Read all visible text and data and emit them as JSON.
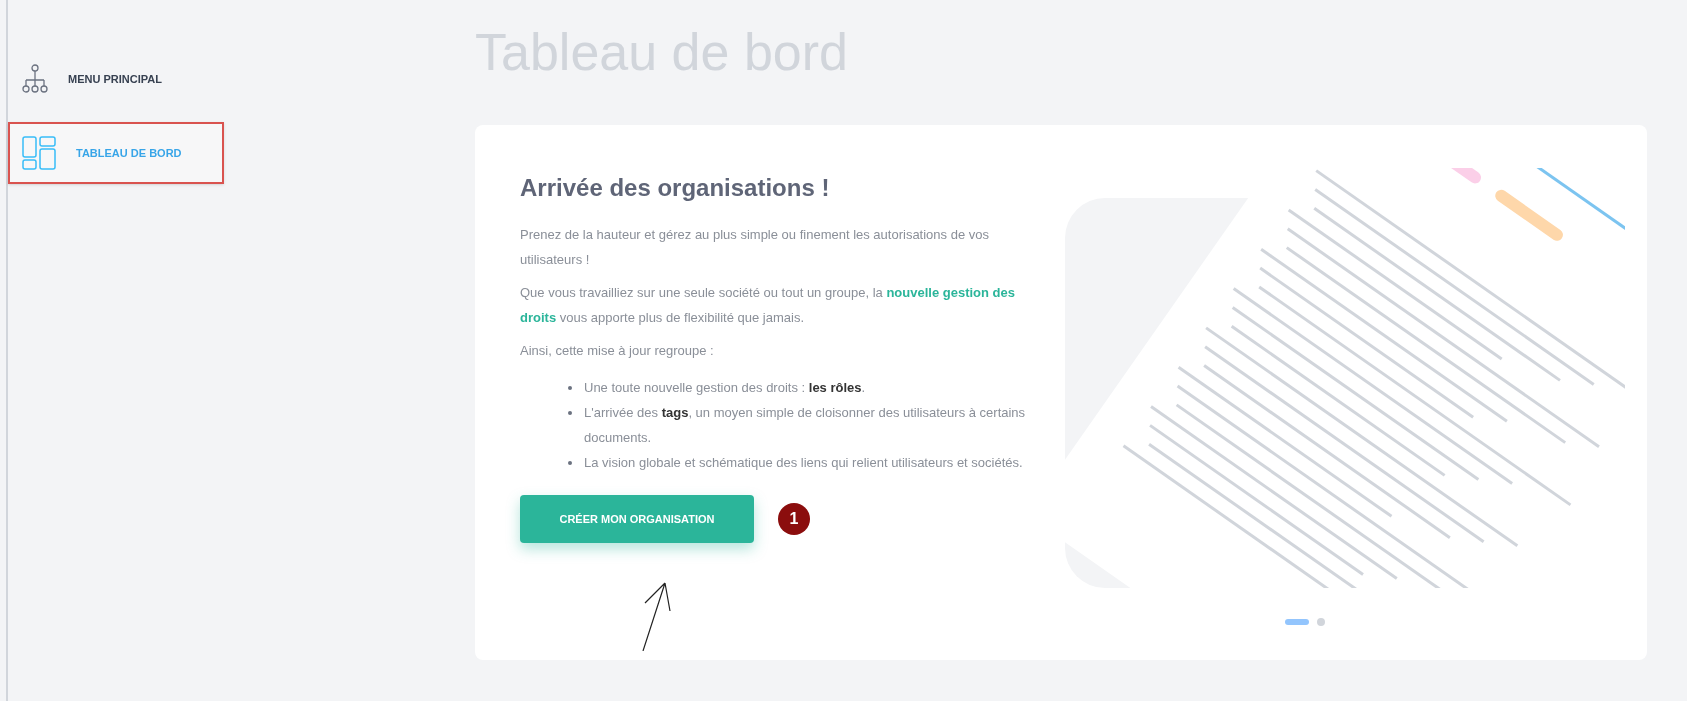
{
  "sidebar": {
    "items": [
      {
        "kind": "tree",
        "label": "MENU PRINCIPAL",
        "selected": false
      },
      {
        "kind": "dashboard",
        "label": "TABLEAU DE BORD",
        "selected": true
      }
    ]
  },
  "page_title": "Tableau de bord",
  "card": {
    "heading": "Arrivée des organisations !",
    "paragraphs": [
      "Prenez de la hauteur et gérez au plus simple ou finement les autorisations de vos utilisateurs !",
      "Que vous travailliez sur une seule société ou tout un groupe, la **nouvelle gestion des droits** vous apporte plus de flexibilité que jamais.",
      "Ainsi, cette mise à jour regroupe :"
    ],
    "list": [
      "Une toute nouvelle gestion des droits : **les rôles**.",
      "L'arrivée des **tags**, un moyen simple de cloisonner des utilisateurs à certains documents.",
      "La vision globale et schématique des liens qui relient utilisateurs et sociétés."
    ],
    "button": "CRÉER MON ORGANISATION",
    "badge": "1",
    "dots": [
      {
        "selected": true
      },
      {
        "selected": false
      }
    ]
  }
}
